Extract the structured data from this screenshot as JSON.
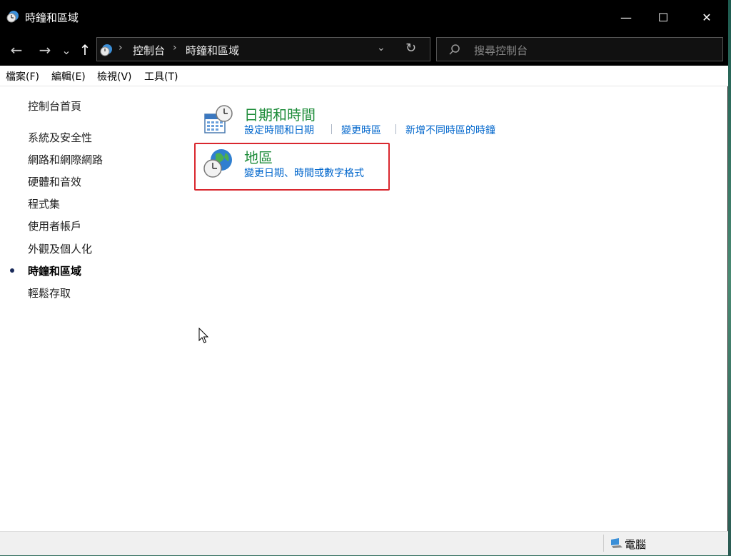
{
  "window": {
    "title": "時鐘和區域"
  },
  "window_controls": {
    "minimize": "—",
    "maximize": "☐",
    "close": "✕"
  },
  "nav": {
    "back": "←",
    "forward": "→",
    "recent": "⌄",
    "up": "↑"
  },
  "address": {
    "crumbs": [
      "控制台",
      "時鐘和區域"
    ],
    "separator": "›",
    "dropdown": "⌄",
    "refresh": "↻"
  },
  "search": {
    "placeholder": "搜尋控制台"
  },
  "menu": [
    "檔案(F)",
    "編輯(E)",
    "檢視(V)",
    "工具(T)"
  ],
  "left_nav": {
    "home": "控制台首頁",
    "items": [
      "系統及安全性",
      "網路和網際網路",
      "硬體和音效",
      "程式集",
      "使用者帳戶",
      "外觀及個人化",
      "時鐘和區域",
      "輕鬆存取"
    ],
    "active_index": 6
  },
  "categories": [
    {
      "title": "日期和時間",
      "icon": "calendar-clock-icon",
      "links": [
        "設定時間和日期",
        "變更時區",
        "新增不同時區的時鐘"
      ]
    },
    {
      "title": "地區",
      "icon": "globe-clock-icon",
      "links": [
        "變更日期、時間或數字格式"
      ]
    }
  ],
  "status": {
    "location": "電腦",
    "icon": "computer-icon"
  },
  "colors": {
    "category_title": "#1e8c3a",
    "link": "#0066cc",
    "highlight_border": "#d9272e",
    "titlebar": "#000000"
  }
}
